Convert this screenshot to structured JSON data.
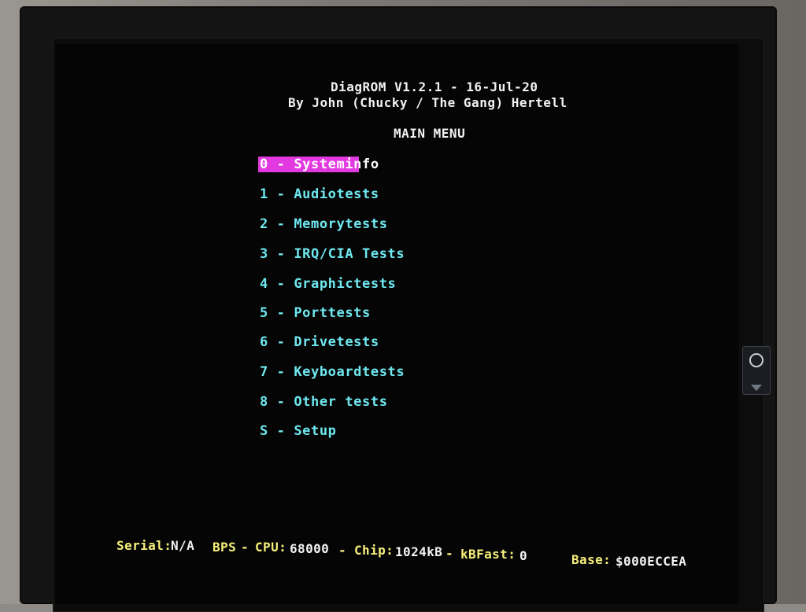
{
  "header": {
    "version_line": "DiagROM V1.2.1 - 16-Jul-20",
    "author_line": "By John (Chucky / The Gang) Hertell",
    "menu_title": "MAIN MENU"
  },
  "menu": {
    "items": [
      {
        "label": "0 - Systeminfo",
        "selected": true
      },
      {
        "label": "1 - Audiotests"
      },
      {
        "label": "2 - Memorytests"
      },
      {
        "label": "3 - IRQ/CIA Tests"
      },
      {
        "label": "4 - Graphictests"
      },
      {
        "label": "5 - Porttests"
      },
      {
        "label": "6 - Drivetests"
      },
      {
        "label": "7 - Keyboardtests"
      },
      {
        "label": "8 - Other tests"
      },
      {
        "label": "S - Setup"
      }
    ]
  },
  "status_bar": {
    "serial_label": "Serial:",
    "serial_value": "N/A",
    "bps_label": "BPS",
    "sep1": "-",
    "cpu_label": "CPU:",
    "cpu_value": "68000",
    "sep2": "-",
    "chip_label": "Chip:",
    "chip_value": "1024kB",
    "sep3": "-",
    "fast_label": "kBFast:",
    "fast_value": "0",
    "base_label": "Base:",
    "base_value": "$000ECCEA"
  },
  "colors": {
    "text_white": "#f2f2f2",
    "menu_cyan": "#6fe8f0",
    "status_yellow": "#f6ef7a",
    "selection_magenta": "#e23ae0",
    "screen_bg": "#050505"
  },
  "icons": {
    "monitor_badge": "lightbulb-icon"
  }
}
